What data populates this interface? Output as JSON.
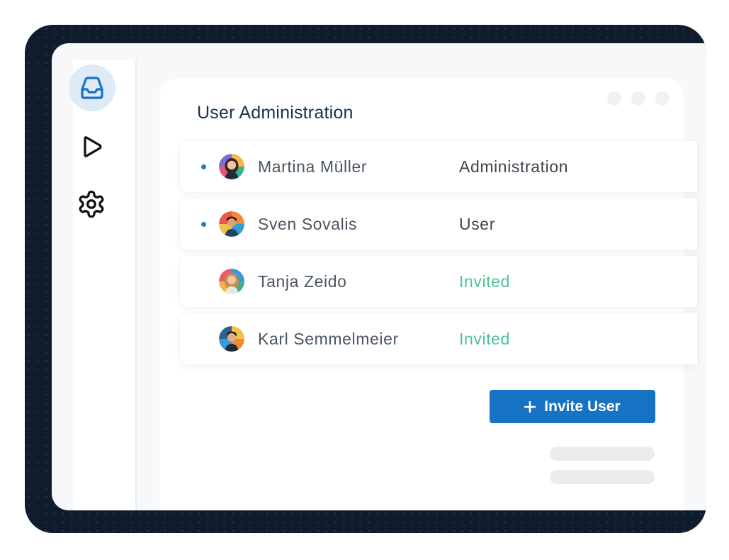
{
  "page": {
    "title": "User Administration"
  },
  "sidebar": {
    "items": [
      {
        "icon": "inbox-icon",
        "active": true
      },
      {
        "icon": "play-icon",
        "active": false
      },
      {
        "icon": "gear-icon",
        "active": false
      }
    ]
  },
  "users": [
    {
      "name": "Martina Müller",
      "role": "Administration",
      "status_dot": true
    },
    {
      "name": "Sven Sovalis",
      "role": "User",
      "status_dot": true
    },
    {
      "name": "Tanja Zeido",
      "role": "Invited",
      "status_dot": false
    },
    {
      "name": "Karl Semmelmeier",
      "role": "Invited",
      "status_dot": false
    }
  ],
  "actions": {
    "invite_label": "Invite User"
  },
  "colors": {
    "accent": "#1672c2",
    "invited": "#4fc493",
    "title": "#16324f",
    "frame": "#0f1c2b"
  }
}
